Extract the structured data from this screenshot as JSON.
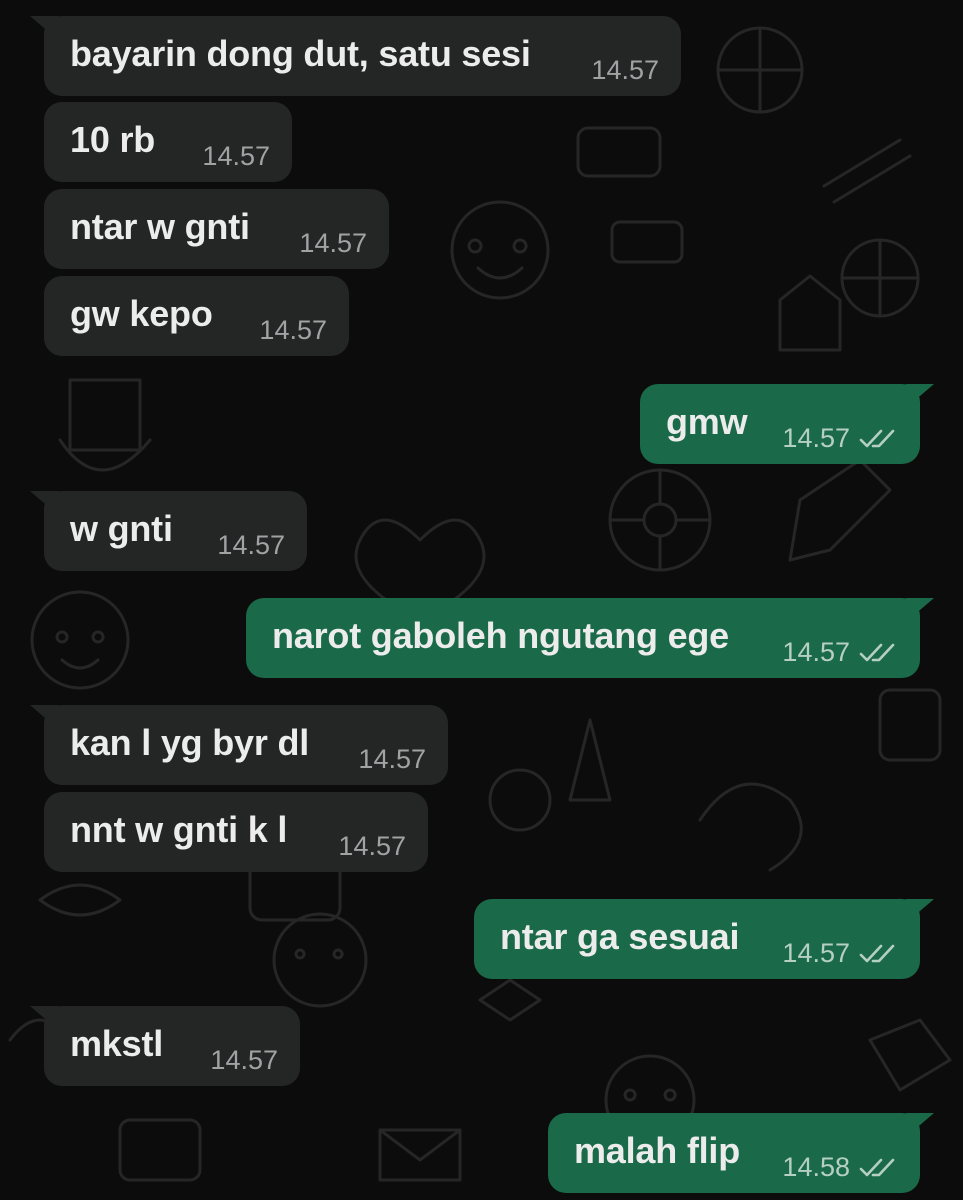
{
  "colors": {
    "background": "#0c0c0c",
    "incoming_bubble": "#242626",
    "outgoing_bubble": "#1a6a49",
    "text": "#ececec",
    "time_incoming": "#9fa3a3",
    "time_outgoing": "#b6cfc3"
  },
  "messages": [
    {
      "direction": "incoming",
      "text": "bayarin dong dut, satu sesi",
      "time": "14.57"
    },
    {
      "direction": "incoming",
      "text": "10 rb",
      "time": "14.57"
    },
    {
      "direction": "incoming",
      "text": "ntar w gnti",
      "time": "14.57"
    },
    {
      "direction": "incoming",
      "text": "gw kepo",
      "time": "14.57"
    },
    {
      "direction": "outgoing",
      "text": "gmw",
      "time": "14.57",
      "status_icon": "double-check-icon"
    },
    {
      "direction": "incoming",
      "text": "w gnti",
      "time": "14.57"
    },
    {
      "direction": "outgoing",
      "text": "narot gaboleh ngutang ege",
      "time": "14.57",
      "status_icon": "double-check-icon"
    },
    {
      "direction": "incoming",
      "text": "kan l yg byr dl",
      "time": "14.57"
    },
    {
      "direction": "incoming",
      "text": "nnt w gnti k l",
      "time": "14.57"
    },
    {
      "direction": "outgoing",
      "text": "ntar ga sesuai",
      "time": "14.57",
      "status_icon": "double-check-icon"
    },
    {
      "direction": "incoming",
      "text": "mkstl",
      "time": "14.57"
    },
    {
      "direction": "outgoing",
      "text": "malah flip",
      "time": "14.58",
      "status_icon": "double-check-icon"
    }
  ]
}
